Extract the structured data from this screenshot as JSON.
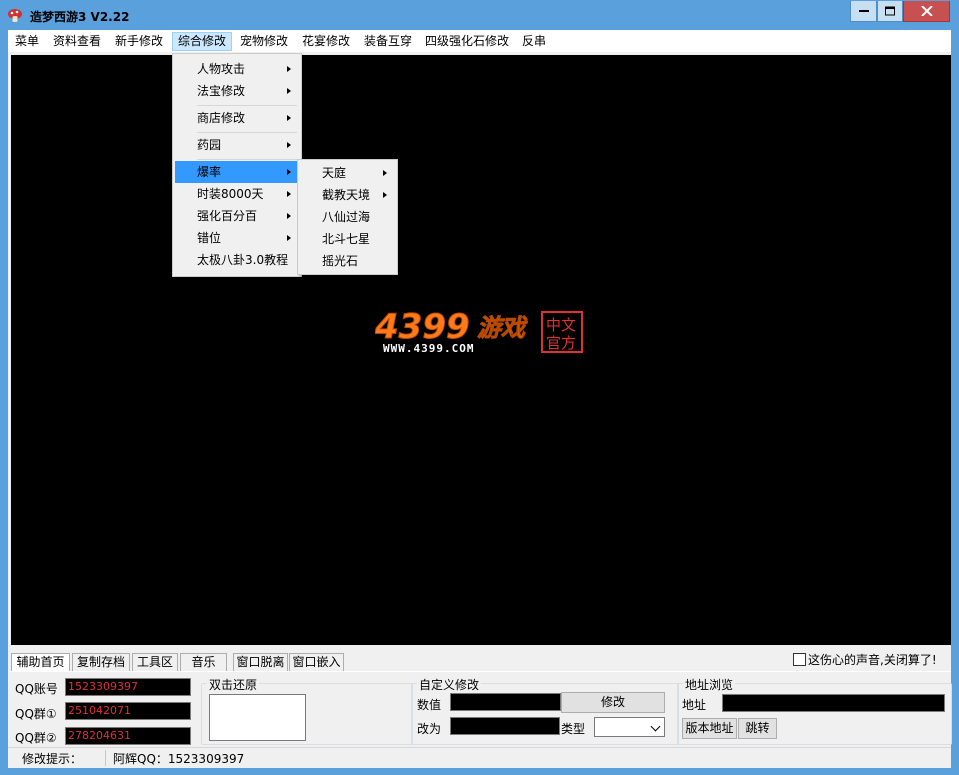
{
  "window": {
    "title": "造梦西游3 V2.22",
    "icon": "mushroom-icon",
    "buttons": [
      "minimize-icon",
      "maximize-icon",
      "close-icon"
    ]
  },
  "menubar": {
    "items": [
      "菜单",
      "资料查看",
      "新手修改",
      "综合修改",
      "宠物修改",
      "花宴修改",
      "装备互穿",
      "四级强化石修改",
      "反串"
    ]
  },
  "dropdown": {
    "items": [
      "人物攻击",
      "法宝修改",
      "商店修改",
      "药园",
      "爆率",
      "时装8000天",
      "强化百分百",
      "错位",
      "太极八卦3.0教程"
    ]
  },
  "submenu": {
    "items": [
      "天庭",
      "截教天境",
      "八仙过海",
      "北斗七星",
      "摇光石"
    ]
  },
  "logo": {
    "text": "4399游戏",
    "url": "WWW.4399.COM",
    "stamp": "中文官方"
  },
  "tabs": [
    "辅助首页",
    "复制存档",
    "工具区",
    "音乐",
    "窗口脱离",
    "窗口嵌入"
  ],
  "sound_checkbox": "这伤心的声音,关闭算了!",
  "panel": {
    "qq_account_label": "QQ账号",
    "qq_account": "1523309397",
    "qq_group1_label": "QQ群①",
    "qq_group1": "251042071",
    "qq_group2_label": "QQ群②",
    "qq_group2": "278204631",
    "restore_title": "双击还原",
    "custom_title": "自定义修改",
    "value_label": "数值",
    "modify_btn": "修改",
    "change_to_label": "改为",
    "type_label": "类型",
    "address_title": "地址浏览",
    "address_label": "地址",
    "version_addr_btn": "版本地址",
    "jump_btn": "跳转"
  },
  "status": {
    "hint": "修改提示：",
    "author": "阿辉QQ：1523309397"
  }
}
